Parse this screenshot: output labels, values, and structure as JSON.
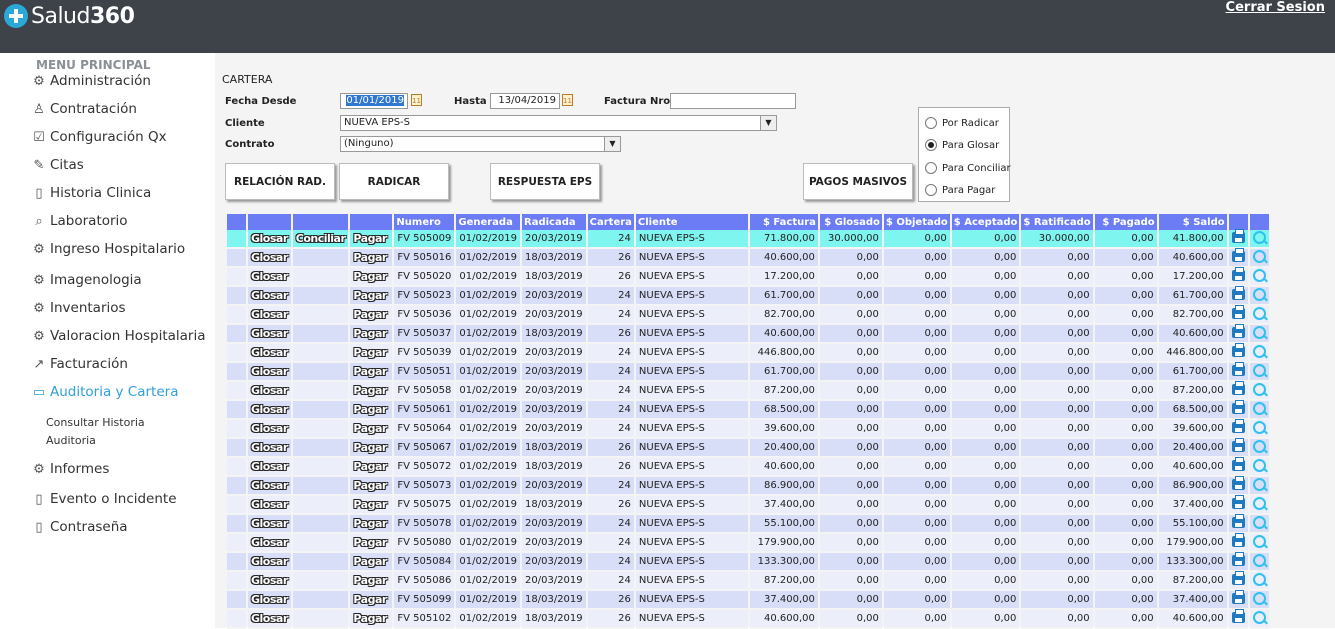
{
  "app": {
    "brand_light": "Salud",
    "brand_bold": "360",
    "logout": "Cerrar Sesion"
  },
  "sidebar": {
    "title": "MENU PRINCIPAL",
    "items": [
      {
        "label": "Administración",
        "icon": "gear-icon"
      },
      {
        "label": "Contratación",
        "icon": "user-icon"
      },
      {
        "label": "Configuración Qx",
        "icon": "checkbox-icon"
      },
      {
        "label": "Citas",
        "icon": "edit-icon"
      },
      {
        "label": "Historia Clinica",
        "icon": "book-icon"
      },
      {
        "label": "Laboratorio",
        "icon": "search-icon"
      },
      {
        "label": "Ingreso Hospitalario",
        "icon": "gear-icon"
      },
      {
        "label": "Imagenologia",
        "icon": "gear-icon"
      },
      {
        "label": "Inventarios",
        "icon": "gear-icon"
      },
      {
        "label": "Valoracion Hospitalaria",
        "icon": "gear-icon"
      },
      {
        "label": "Facturación",
        "icon": "chart-line-icon"
      },
      {
        "label": "Auditoria y Cartera",
        "icon": "clipboard-icon"
      },
      {
        "label": "Informes",
        "icon": "gear-icon"
      },
      {
        "label": "Evento o Incidente",
        "icon": "book-icon"
      },
      {
        "label": "Contraseña",
        "icon": "book-icon"
      }
    ],
    "submenu": [
      "Consultar Historia",
      "Auditoria"
    ]
  },
  "form": {
    "title": "CARTERA",
    "fecha_desde_label": "Fecha Desde",
    "fecha_desde": "01/01/2019",
    "hasta_label": "Hasta",
    "hasta": "13/04/2019",
    "factura_label": "Factura Nro",
    "factura": "",
    "cliente_label": "Cliente",
    "cliente": "NUEVA EPS-S",
    "contrato_label": "Contrato",
    "contrato": "(Ninguno)"
  },
  "buttons": {
    "relacion": "RELACIÓN  RAD.",
    "radicar": "RADICAR",
    "respuesta": "RESPUESTA EPS",
    "pagos": "PAGOS MASIVOS"
  },
  "radios": {
    "options": [
      "Por Radicar",
      "Para Glosar",
      "Para Conciliar",
      "Para Pagar"
    ],
    "selected": "Para Glosar"
  },
  "table": {
    "headers": [
      "",
      "",
      "",
      "",
      "Numero",
      "Generada",
      "Radicada",
      "Cartera",
      "Cliente",
      "$ Factura",
      "$ Glosado",
      "$ Objetado",
      "$ Aceptado",
      "$ Ratificado",
      "$ Pagado",
      "$ Saldo",
      "",
      ""
    ],
    "action_glosar": "Glosar",
    "action_conciliar": "Conciliar",
    "action_pagar": "Pagar",
    "rows": [
      {
        "numero": "FV 505009",
        "generada": "01/02/2019",
        "radicada": "20/03/2019",
        "cartera": "24",
        "cliente": "NUEVA EPS-S",
        "factura": "71.800,00",
        "glosado": "30.000,00",
        "objetado": "0,00",
        "aceptado": "0,00",
        "ratificado": "30.000,00",
        "pagado": "0,00",
        "saldo": "41.800,00",
        "conciliar": true
      },
      {
        "numero": "FV 505016",
        "generada": "01/02/2019",
        "radicada": "18/03/2019",
        "cartera": "26",
        "cliente": "NUEVA EPS-S",
        "factura": "40.600,00",
        "glosado": "0,00",
        "objetado": "0,00",
        "aceptado": "0,00",
        "ratificado": "0,00",
        "pagado": "0,00",
        "saldo": "40.600,00"
      },
      {
        "numero": "FV 505020",
        "generada": "01/02/2019",
        "radicada": "18/03/2019",
        "cartera": "26",
        "cliente": "NUEVA EPS-S",
        "factura": "17.200,00",
        "glosado": "0,00",
        "objetado": "0,00",
        "aceptado": "0,00",
        "ratificado": "0,00",
        "pagado": "0,00",
        "saldo": "17.200,00"
      },
      {
        "numero": "FV 505023",
        "generada": "01/02/2019",
        "radicada": "20/03/2019",
        "cartera": "24",
        "cliente": "NUEVA EPS-S",
        "factura": "61.700,00",
        "glosado": "0,00",
        "objetado": "0,00",
        "aceptado": "0,00",
        "ratificado": "0,00",
        "pagado": "0,00",
        "saldo": "61.700,00"
      },
      {
        "numero": "FV 505036",
        "generada": "01/02/2019",
        "radicada": "20/03/2019",
        "cartera": "24",
        "cliente": "NUEVA EPS-S",
        "factura": "82.700,00",
        "glosado": "0,00",
        "objetado": "0,00",
        "aceptado": "0,00",
        "ratificado": "0,00",
        "pagado": "0,00",
        "saldo": "82.700,00"
      },
      {
        "numero": "FV 505037",
        "generada": "01/02/2019",
        "radicada": "18/03/2019",
        "cartera": "26",
        "cliente": "NUEVA EPS-S",
        "factura": "40.600,00",
        "glosado": "0,00",
        "objetado": "0,00",
        "aceptado": "0,00",
        "ratificado": "0,00",
        "pagado": "0,00",
        "saldo": "40.600,00"
      },
      {
        "numero": "FV 505039",
        "generada": "01/02/2019",
        "radicada": "20/03/2019",
        "cartera": "24",
        "cliente": "NUEVA EPS-S",
        "factura": "446.800,00",
        "glosado": "0,00",
        "objetado": "0,00",
        "aceptado": "0,00",
        "ratificado": "0,00",
        "pagado": "0,00",
        "saldo": "446.800,00"
      },
      {
        "numero": "FV 505051",
        "generada": "01/02/2019",
        "radicada": "20/03/2019",
        "cartera": "24",
        "cliente": "NUEVA EPS-S",
        "factura": "61.700,00",
        "glosado": "0,00",
        "objetado": "0,00",
        "aceptado": "0,00",
        "ratificado": "0,00",
        "pagado": "0,00",
        "saldo": "61.700,00"
      },
      {
        "numero": "FV 505058",
        "generada": "01/02/2019",
        "radicada": "20/03/2019",
        "cartera": "24",
        "cliente": "NUEVA EPS-S",
        "factura": "87.200,00",
        "glosado": "0,00",
        "objetado": "0,00",
        "aceptado": "0,00",
        "ratificado": "0,00",
        "pagado": "0,00",
        "saldo": "87.200,00"
      },
      {
        "numero": "FV 505061",
        "generada": "01/02/2019",
        "radicada": "20/03/2019",
        "cartera": "24",
        "cliente": "NUEVA EPS-S",
        "factura": "68.500,00",
        "glosado": "0,00",
        "objetado": "0,00",
        "aceptado": "0,00",
        "ratificado": "0,00",
        "pagado": "0,00",
        "saldo": "68.500,00"
      },
      {
        "numero": "FV 505064",
        "generada": "01/02/2019",
        "radicada": "20/03/2019",
        "cartera": "24",
        "cliente": "NUEVA EPS-S",
        "factura": "39.600,00",
        "glosado": "0,00",
        "objetado": "0,00",
        "aceptado": "0,00",
        "ratificado": "0,00",
        "pagado": "0,00",
        "saldo": "39.600,00"
      },
      {
        "numero": "FV 505067",
        "generada": "01/02/2019",
        "radicada": "18/03/2019",
        "cartera": "26",
        "cliente": "NUEVA EPS-S",
        "factura": "20.400,00",
        "glosado": "0,00",
        "objetado": "0,00",
        "aceptado": "0,00",
        "ratificado": "0,00",
        "pagado": "0,00",
        "saldo": "20.400,00"
      },
      {
        "numero": "FV 505072",
        "generada": "01/02/2019",
        "radicada": "18/03/2019",
        "cartera": "26",
        "cliente": "NUEVA EPS-S",
        "factura": "40.600,00",
        "glosado": "0,00",
        "objetado": "0,00",
        "aceptado": "0,00",
        "ratificado": "0,00",
        "pagado": "0,00",
        "saldo": "40.600,00"
      },
      {
        "numero": "FV 505073",
        "generada": "01/02/2019",
        "radicada": "20/03/2019",
        "cartera": "24",
        "cliente": "NUEVA EPS-S",
        "factura": "86.900,00",
        "glosado": "0,00",
        "objetado": "0,00",
        "aceptado": "0,00",
        "ratificado": "0,00",
        "pagado": "0,00",
        "saldo": "86.900,00"
      },
      {
        "numero": "FV 505075",
        "generada": "01/02/2019",
        "radicada": "18/03/2019",
        "cartera": "26",
        "cliente": "NUEVA EPS-S",
        "factura": "37.400,00",
        "glosado": "0,00",
        "objetado": "0,00",
        "aceptado": "0,00",
        "ratificado": "0,00",
        "pagado": "0,00",
        "saldo": "37.400,00"
      },
      {
        "numero": "FV 505078",
        "generada": "01/02/2019",
        "radicada": "20/03/2019",
        "cartera": "24",
        "cliente": "NUEVA EPS-S",
        "factura": "55.100,00",
        "glosado": "0,00",
        "objetado": "0,00",
        "aceptado": "0,00",
        "ratificado": "0,00",
        "pagado": "0,00",
        "saldo": "55.100,00"
      },
      {
        "numero": "FV 505080",
        "generada": "01/02/2019",
        "radicada": "20/03/2019",
        "cartera": "24",
        "cliente": "NUEVA EPS-S",
        "factura": "179.900,00",
        "glosado": "0,00",
        "objetado": "0,00",
        "aceptado": "0,00",
        "ratificado": "0,00",
        "pagado": "0,00",
        "saldo": "179.900,00"
      },
      {
        "numero": "FV 505084",
        "generada": "01/02/2019",
        "radicada": "20/03/2019",
        "cartera": "24",
        "cliente": "NUEVA EPS-S",
        "factura": "133.300,00",
        "glosado": "0,00",
        "objetado": "0,00",
        "aceptado": "0,00",
        "ratificado": "0,00",
        "pagado": "0,00",
        "saldo": "133.300,00"
      },
      {
        "numero": "FV 505086",
        "generada": "01/02/2019",
        "radicada": "20/03/2019",
        "cartera": "24",
        "cliente": "NUEVA EPS-S",
        "factura": "87.200,00",
        "glosado": "0,00",
        "objetado": "0,00",
        "aceptado": "0,00",
        "ratificado": "0,00",
        "pagado": "0,00",
        "saldo": "87.200,00"
      },
      {
        "numero": "FV 505099",
        "generada": "01/02/2019",
        "radicada": "18/03/2019",
        "cartera": "26",
        "cliente": "NUEVA EPS-S",
        "factura": "37.400,00",
        "glosado": "0,00",
        "objetado": "0,00",
        "aceptado": "0,00",
        "ratificado": "0,00",
        "pagado": "0,00",
        "saldo": "37.400,00"
      },
      {
        "numero": "FV 505102",
        "generada": "01/02/2019",
        "radicada": "18/03/2019",
        "cartera": "26",
        "cliente": "NUEVA EPS-S",
        "factura": "40.600,00",
        "glosado": "0,00",
        "objetado": "0,00",
        "aceptado": "0,00",
        "ratificado": "0,00",
        "pagado": "0,00",
        "saldo": "40.600,00"
      }
    ]
  }
}
